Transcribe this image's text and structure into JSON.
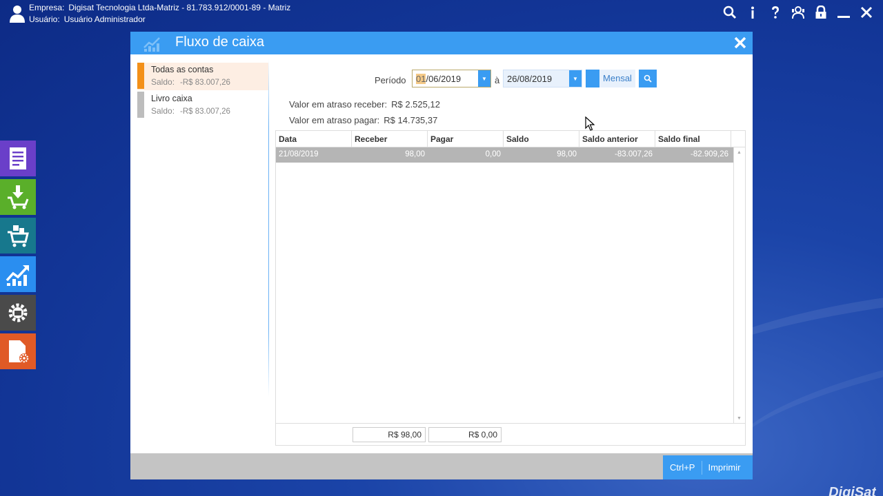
{
  "topbar": {
    "company_label": "Empresa:",
    "company_value": "Digisat Tecnologia Ltda-Matriz - 81.783.912/0001-89 - Matriz",
    "user_label": "Usuário:",
    "user_value": "Usuário Administrador",
    "icons": [
      "search-icon",
      "info-icon",
      "help-icon",
      "support-icon",
      "lock-icon",
      "minimize-icon",
      "close-icon"
    ]
  },
  "dock": {
    "items": [
      {
        "icon": "document-icon",
        "color": "#6a3fc9"
      },
      {
        "icon": "cart-download-icon",
        "color": "#5aaf2a"
      },
      {
        "icon": "cart-boxes-icon",
        "color": "#17788d"
      },
      {
        "icon": "chart-up-icon",
        "color": "#2a8ef0"
      },
      {
        "icon": "gear-icon",
        "color": "#4a4a4a"
      },
      {
        "icon": "file-settings-icon",
        "color": "#e05a26"
      }
    ]
  },
  "dialog": {
    "title": "Fluxo de caixa",
    "header_color": "#3a9cf2",
    "accounts": [
      {
        "name": "Todas as contas",
        "balance_label": "Saldo:",
        "balance": "-R$ 83.007,26",
        "active": true
      },
      {
        "name": "Livro caixa",
        "balance_label": "Saldo:",
        "balance": "-R$ 83.007,26",
        "active": false
      }
    ],
    "period": {
      "label": "Período",
      "start_sel": "01",
      "start_rest": "/06/2019",
      "separator": "à",
      "end": "26/08/2019",
      "mode": "Mensal"
    },
    "late": {
      "receive_label": "Valor em atraso receber:",
      "receive_value": "R$ 2.525,12",
      "pay_label": "Valor em atraso pagar:",
      "pay_value": "R$ 14.735,37"
    },
    "grid": {
      "columns": [
        "Data",
        "Receber",
        "Pagar",
        "Saldo",
        "Saldo anterior",
        "Saldo final"
      ],
      "rows": [
        [
          "21/08/2019",
          "98,00",
          "0,00",
          "98,00",
          "-83.007,26",
          "-82.909,26"
        ]
      ],
      "totals": {
        "receber": "R$ 98,00",
        "pagar": "R$ 0,00"
      }
    },
    "print": {
      "shortcut": "Ctrl+P",
      "label": "Imprimir"
    }
  },
  "brand": "DigiSat"
}
